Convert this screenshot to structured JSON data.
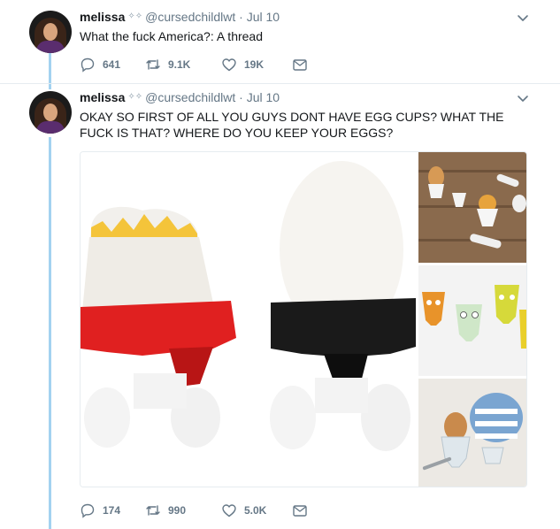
{
  "tweets": [
    {
      "display_name": "melissa",
      "handle": "@cursedchildlwt",
      "separator": "·",
      "date": "Jul 10",
      "text": "What the fuck America?: A thread",
      "replies": "641",
      "retweets": "9.1K",
      "likes": "19K"
    },
    {
      "display_name": "melissa",
      "handle": "@cursedchildlwt",
      "separator": "·",
      "date": "Jul 10",
      "text_line1": "OKAY SO FIRST OF ALL YOU GUYS DONT HAVE EGG CUPS? WHAT THE",
      "text_line2": "FUCK IS THAT? WHERE DO YOU KEEP YOUR EGGS?",
      "replies": "174",
      "retweets": "990",
      "likes": "5.0K"
    }
  ],
  "colors": {
    "thread_line": "#a3d2f0",
    "secondary_text": "#657786",
    "sumo_red": "#e02020",
    "sumo_black": "#1a1a1a"
  },
  "icons": [
    "chevron-down-icon",
    "reply-icon",
    "retweet-icon",
    "like-icon",
    "direct-message-icon"
  ]
}
